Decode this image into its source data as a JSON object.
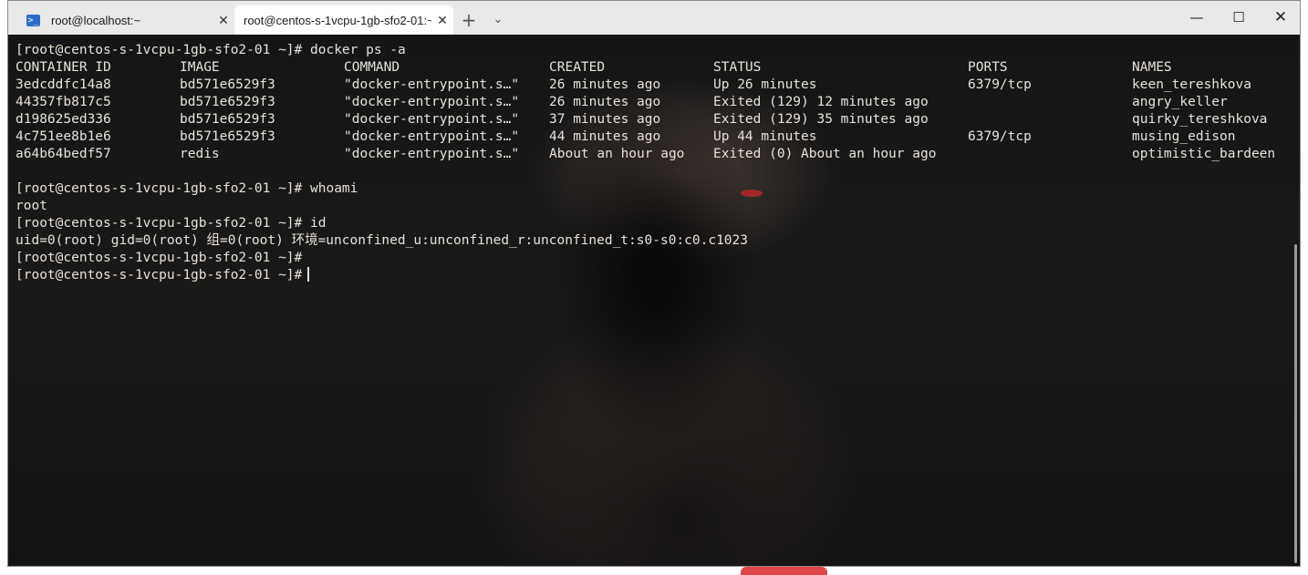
{
  "tabs": [
    {
      "label": "root@localhost:~",
      "icon": "powershell-icon",
      "active": false
    },
    {
      "label": "root@centos-s-1vcpu-1gb-sfo2-01:~",
      "active": true
    }
  ],
  "new_tab_symbol": "+",
  "dropdown_symbol": "⌄",
  "window_controls": {
    "minimize": "—",
    "maximize": "☐",
    "close": "✕"
  },
  "terminal": {
    "prompt": "[root@centos-s-1vcpu-1gb-sfo2-01 ~]# ",
    "cmd_docker": "[root@centos-s-1vcpu-1gb-sfo2-01 ~]# docker ps -a",
    "headers": [
      "CONTAINER ID",
      "IMAGE",
      "COMMAND",
      "CREATED",
      "STATUS",
      "PORTS",
      "NAMES"
    ],
    "rows": [
      [
        "3edcddfc14a8",
        "bd571e6529f3",
        "\"docker-entrypoint.s…\"",
        "26 minutes ago",
        "Up 26 minutes",
        "6379/tcp",
        "keen_tereshkova"
      ],
      [
        "44357fb817c5",
        "bd571e6529f3",
        "\"docker-entrypoint.s…\"",
        "26 minutes ago",
        "Exited (129) 12 minutes ago",
        "",
        "angry_keller"
      ],
      [
        "d198625ed336",
        "bd571e6529f3",
        "\"docker-entrypoint.s…\"",
        "37 minutes ago",
        "Exited (129) 35 minutes ago",
        "",
        "quirky_tereshkova"
      ],
      [
        "4c751ee8b1e6",
        "bd571e6529f3",
        "\"docker-entrypoint.s…\"",
        "44 minutes ago",
        "Up 44 minutes",
        "6379/tcp",
        "musing_edison"
      ],
      [
        "a64b64bedf57",
        "redis",
        "\"docker-entrypoint.s…\"",
        "About an hour ago",
        "Exited (0) About an hour ago",
        "",
        "optimistic_bardeen"
      ]
    ],
    "cmd_whoami": "[root@centos-s-1vcpu-1gb-sfo2-01 ~]# whoami",
    "out_whoami": "root",
    "cmd_id": "[root@centos-s-1vcpu-1gb-sfo2-01 ~]# id",
    "out_id": "uid=0(root) gid=0(root) 组=0(root) 环境=unconfined_u:unconfined_r:unconfined_t:s0-s0:c0.c1023",
    "prompt_empty": "[root@centos-s-1vcpu-1gb-sfo2-01 ~]#",
    "prompt_current": "[root@centos-s-1vcpu-1gb-sfo2-01 ~]#"
  },
  "colors": {
    "terminal_text": "#e8e2d9",
    "terminal_bg": "#141516",
    "tabbar_bg": "#e9e9e9",
    "active_tab_bg": "#ffffff"
  }
}
